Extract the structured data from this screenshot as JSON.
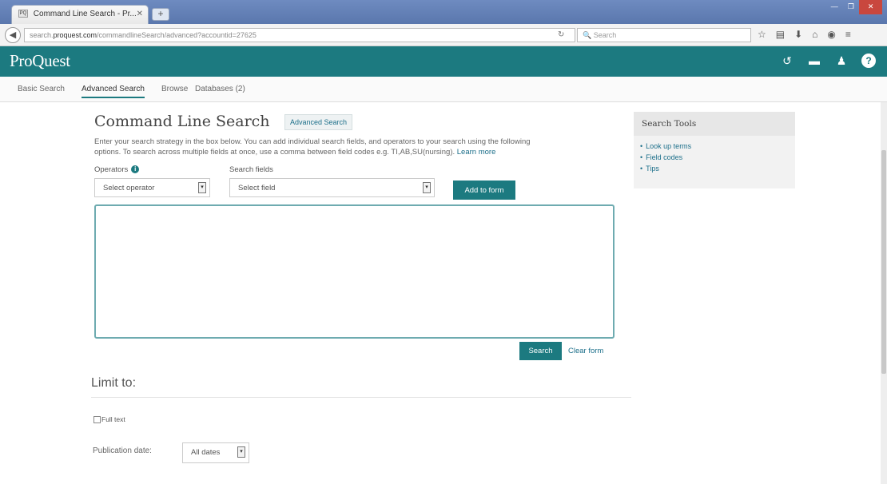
{
  "browser": {
    "tab_title": "Command Line Search - Pr...",
    "favicon_text": "PQ",
    "new_tab": "+",
    "url_prefix": "search.",
    "url_host": "proquest.com",
    "url_path": "/commandlineSearch/advanced?accountid=27625",
    "search_placeholder": "Search",
    "window_controls": [
      "—",
      "❐",
      "✕"
    ]
  },
  "header": {
    "logo": "ProQuest"
  },
  "subnav": {
    "items": [
      "Basic Search",
      "Advanced Search",
      "Browse",
      "Databases (2)"
    ]
  },
  "main": {
    "title": "Command Line Search",
    "advanced_link": "Advanced Search",
    "intro_line1": "Enter your search strategy in the box below. You can add individual search fields, and operators to your search using the following",
    "intro_line2": "options. To search across multiple fields at once, use a comma between field codes e.g. TI,AB,SU(nursing).",
    "learn_more": "Learn more",
    "operators_label": "Operators",
    "operators_select": "Select operator",
    "fields_label": "Search fields",
    "fields_select": "Select field",
    "add_button": "Add to form",
    "search_button": "Search",
    "clear_link": "Clear form",
    "limit_title": "Limit to:",
    "fulltext_label": "Full text",
    "pubdate_label": "Publication date:",
    "pubdate_select": "All dates"
  },
  "tools": {
    "title": "Search Tools",
    "items": [
      "Look up terms",
      "Field codes",
      "Tips"
    ]
  },
  "colors": {
    "brand_teal": "#1c7a80",
    "link": "#1c6f8a"
  }
}
